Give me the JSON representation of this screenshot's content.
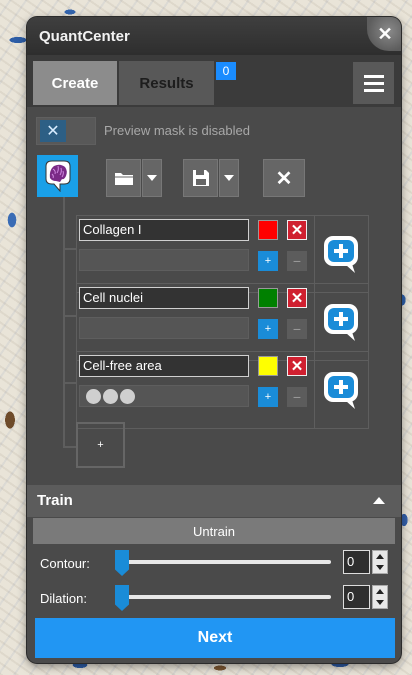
{
  "window": {
    "title": "QuantCenter"
  },
  "tabs": {
    "create": "Create",
    "results": "Results",
    "results_badge": "0"
  },
  "preview": {
    "label": "Preview mask is disabled",
    "enabled": false
  },
  "labels": [
    {
      "name": "Collagen I",
      "color": "#ff0000"
    },
    {
      "name": "Cell nuclei",
      "color": "#008000"
    },
    {
      "name": "Cell-free area",
      "color": "#ffff00"
    }
  ],
  "controls": {
    "add_label": "+",
    "add_small": "+",
    "remove_small": "−"
  },
  "train": {
    "title": "Train",
    "untrain_label": "Untrain",
    "contour": {
      "label": "Contour:",
      "value": "0"
    },
    "dilation": {
      "label": "Dilation:",
      "value": "0"
    }
  },
  "footer": {
    "next_label": "Next"
  },
  "colors": {
    "accent": "#2196f3",
    "panel": "#4a4a4a",
    "delete": "#d02030"
  }
}
